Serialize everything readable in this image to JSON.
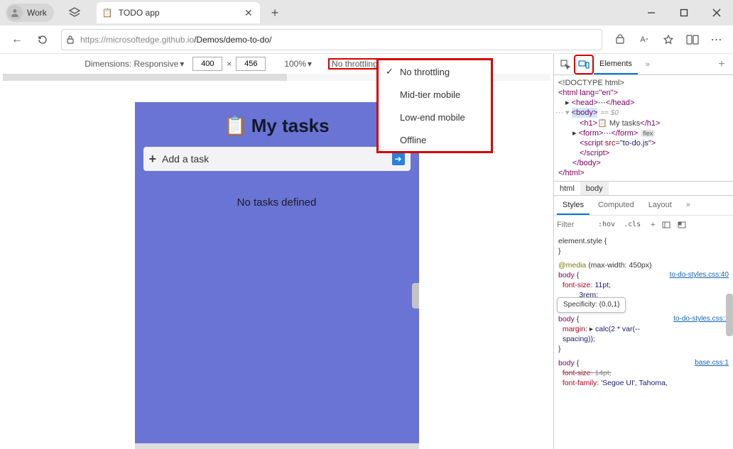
{
  "titlebar": {
    "profile_label": "Work",
    "tab_title": "TODO app"
  },
  "toolbar": {
    "url_host": "https://microsoftedge.github.io",
    "url_path": "/Demos/demo-to-do/"
  },
  "device_bar": {
    "dimensions_label": "Dimensions: Responsive",
    "width": "400",
    "height": "456",
    "x": "×",
    "zoom": "100%",
    "throttling": "No throttling"
  },
  "throttling_menu": [
    "No throttling",
    "Mid-tier mobile",
    "Low-end mobile",
    "Offline"
  ],
  "app": {
    "heading": "My tasks",
    "add_task": "Add a task",
    "no_tasks": "No tasks defined"
  },
  "devtools": {
    "elements_tab": "Elements",
    "tree": {
      "doctype": "<!DOCTYPE html>",
      "html_open": "<html lang=\"en\">",
      "head": "<head>…</head>",
      "body_open": "<body>",
      "dollar0": "== $0",
      "h1": "<h1>📋 My tasks</h1>",
      "form": "<form>…</form>",
      "flex": "flex",
      "script": "<script src=\"to-do.js\">",
      "script_close": "</script>",
      "body_close": "</body>",
      "html_close": "</html>"
    },
    "crumbs": [
      "html",
      "body"
    ],
    "styles_tabs": [
      "Styles",
      "Computed",
      "Layout"
    ],
    "filter": {
      "placeholder": "Filter",
      "hov": ":hov",
      "cls": ".cls"
    },
    "tooltip": "Specificity: (0,0,1)",
    "rules": {
      "r0": "element.style {",
      "r0c": "}",
      "r1_media": "@media (max-width: 450px)",
      "r1_sel": "body {",
      "r1_src": "to-do-styles.css:40",
      "r1_p1": "font-size: 11pt;",
      "r1_p2": "3rem;",
      "r2_sel": "body {",
      "r2_src": "to-do-styles.css:1",
      "r2_p1a": "margin: ▸ calc(2 * var(--",
      "r2_p1b": "spacing));",
      "r3_sel": "body {",
      "r3_src": "base.css:1",
      "r3_p1": "font-size: 14pt;",
      "r3_p2": "font-family: 'Segoe UI', Tahoma,"
    }
  }
}
